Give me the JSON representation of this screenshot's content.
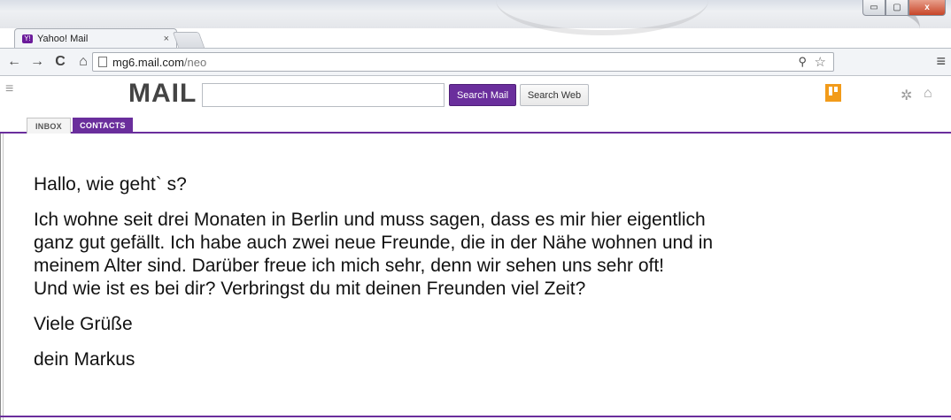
{
  "browser": {
    "tab_title": "Yahoo! Mail",
    "tab_close": "×",
    "favicon_text": "Y!",
    "url_host": "mg6.mail.com",
    "url_path": "/neo",
    "nav": {
      "back": "←",
      "forward": "→",
      "reload": "C",
      "home": "⌂"
    },
    "zoom_glyph": "⚲",
    "star_glyph": "☆",
    "menu_glyph": "≡",
    "window_controls": {
      "minimize": "▭",
      "maximize": "▢",
      "close": "x"
    }
  },
  "app": {
    "menu_glyph": "≡",
    "logo": "MAIL",
    "search": {
      "value": "",
      "placeholder": ""
    },
    "search_mail_label": "Search Mail",
    "search_web_label": "Search Web",
    "gear_glyph": "✲",
    "home_glyph": "⌂",
    "accent_color": "#6a2e9c",
    "notification_color": "#f29b1a"
  },
  "tabs": [
    {
      "label": "INBOX",
      "active": false
    },
    {
      "label": "CONTACTS",
      "active": true
    }
  ],
  "message": {
    "greeting": "Hallo, wie geht` s?",
    "body_lines": [
      "Ich wohne seit drei Monaten in Berlin und muss sagen, dass es mir hier eigentlich",
      "ganz gut gefällt. Ich habe auch zwei neue Freunde, die in der Nähe wohnen und in",
      "meinem Alter sind. Darüber freue ich mich sehr, denn wir sehen uns sehr oft!",
      "Und wie ist es bei dir? Verbringst du mit deinen Freunden viel Zeit?"
    ],
    "closing": "Viele Grüße",
    "signature": "dein Markus"
  }
}
